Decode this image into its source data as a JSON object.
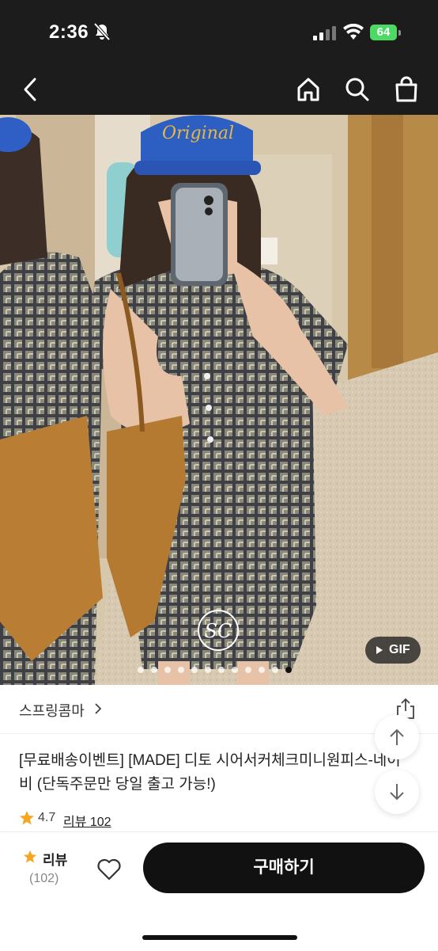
{
  "status": {
    "time": "2:36",
    "battery": "64"
  },
  "nav": {
    "icons": [
      "back-icon",
      "home-icon",
      "search-icon",
      "shopping-bag-icon"
    ]
  },
  "product_image": {
    "watermark": "SC",
    "gif_label": "GIF",
    "dot_count": 12,
    "active_dot": 12
  },
  "shop": {
    "name": "스프링콤마"
  },
  "product": {
    "title": "[무료배송이벤트] [MADE] 디토 시어서커체크미니원피스-네이비 (단독주문만 당일 출고 가능!)",
    "rating": "4.7",
    "review_link": "리뷰 102"
  },
  "bottom_bar": {
    "review_label": "리뷰",
    "review_count": "(102)",
    "buy_label": "구매하기"
  },
  "colors": {
    "topbar": "#1c1c1c",
    "star": "#f5a623",
    "battery": "#4cd964",
    "buy_button": "#111111"
  }
}
